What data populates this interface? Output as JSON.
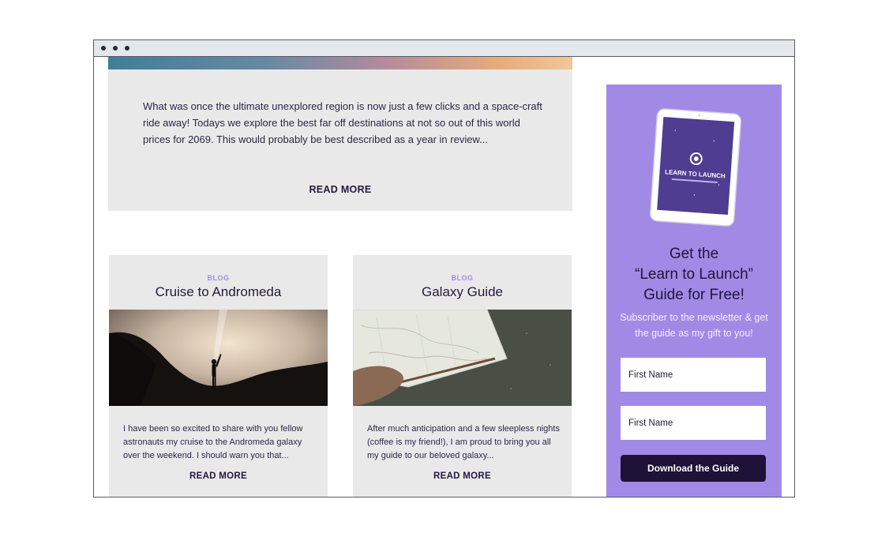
{
  "featured_post": {
    "excerpt": "What was once the ultimate unexplored region is now just a few clicks and a space-craft ride away! Todays we explore the best far off destinations at not so out of this world prices for 2069. This would probably be best described as a year in review...",
    "read_more_label": "READ MORE"
  },
  "posts": [
    {
      "tag": "BLOG",
      "title": "Cruise to Andromeda",
      "excerpt": "I have been so excited to share with you fellow astronauts my cruise to the Andromeda galaxy over the weekend. I should warn you that...",
      "read_more_label": "READ MORE"
    },
    {
      "tag": "BLOG",
      "title": "Galaxy Guide",
      "excerpt": "After much anticipation and a few sleepless nights (coffee is my friend!), I am proud to bring you all my guide to our beloved galaxy...",
      "read_more_label": "READ MORE"
    }
  ],
  "sidebar": {
    "tablet_cover_title": "LEARN TO LAUNCH",
    "heading_line1": "Get the",
    "heading_line2": "“Learn to Launch”",
    "heading_line3": "Guide for Free!",
    "subtext": "Subscriber to the newsletter & get the guide as my gift to you!",
    "first_name_placeholder": "First Name",
    "second_field_placeholder": "First Name",
    "button_label": "Download the Guide",
    "background_color": "#a18ae6",
    "button_color": "#1e1238"
  }
}
